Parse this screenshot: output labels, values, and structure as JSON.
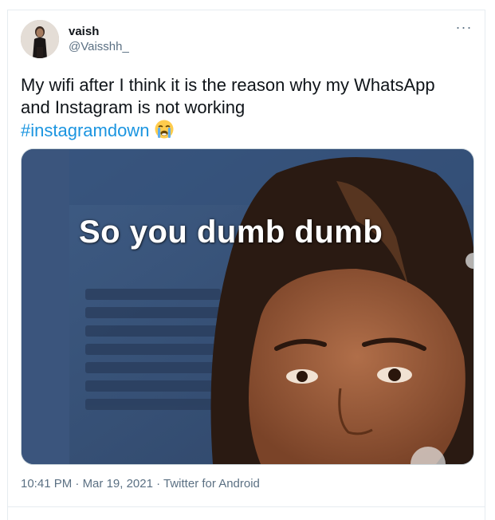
{
  "user": {
    "name": "vaish",
    "handle": "@Vaisshh_"
  },
  "tweet": {
    "text": "My wifi after I think it is the reason why my WhatsApp and Instagram is not working",
    "hashtag": "#instagramdown",
    "emoji": "loudly-crying-face"
  },
  "media": {
    "caption": "So you dumb dumb"
  },
  "meta": {
    "time": "10:41 PM",
    "sep1": " · ",
    "date": "Mar 19, 2021",
    "sep2": " · ",
    "source": "Twitter for Android"
  },
  "menu": {
    "more_label": "···"
  },
  "colors": {
    "link": "#1b95e0",
    "muted": "#5b7083",
    "text": "#0f1419"
  }
}
